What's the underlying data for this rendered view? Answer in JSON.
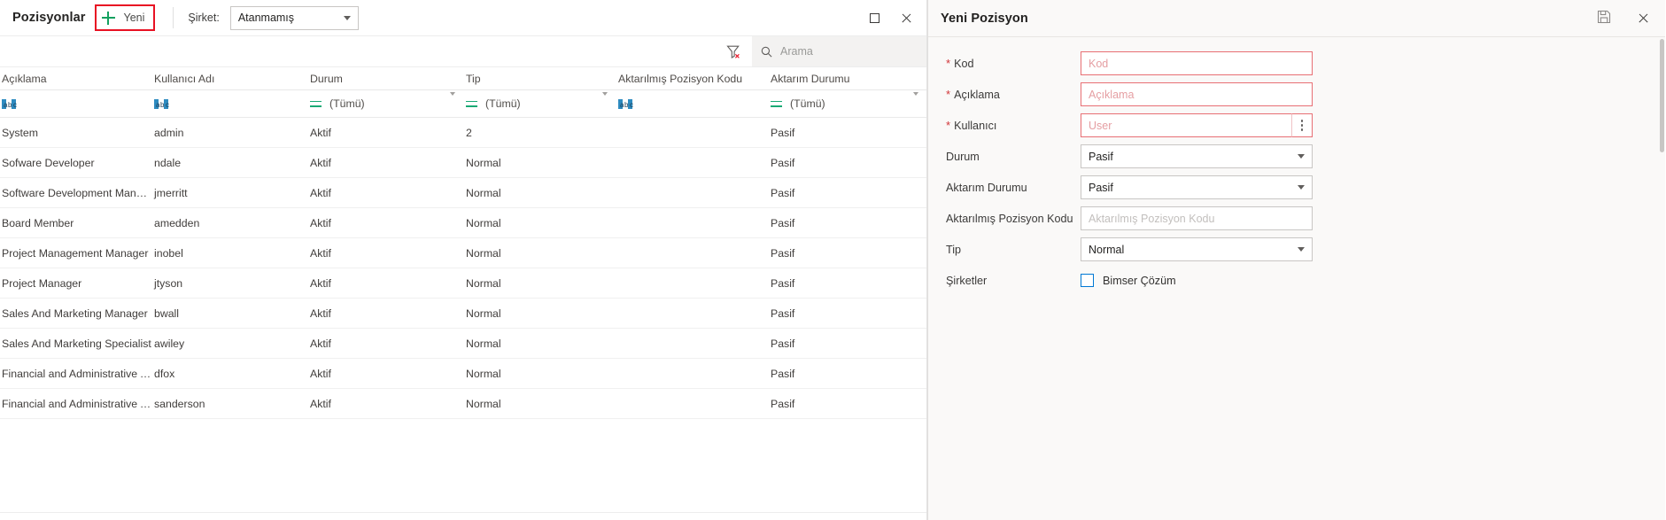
{
  "grid": {
    "toolbar": {
      "title": "Pozisyonlar",
      "new_label": "Yeni",
      "new_icon": "plus-icon",
      "company_label": "Şirket:",
      "company_value": "Atanmamış",
      "restore_icon": "restore-window-icon",
      "close_icon": "close-icon",
      "highlight_color": "#e81123",
      "plus_color": "#13a05f"
    },
    "search": {
      "clear_filter_icon": "funnel-clear-icon",
      "search_icon": "search-icon",
      "placeholder": "Arama",
      "value": ""
    },
    "columns": [
      "Açıklama",
      "Kullanıcı Adı",
      "Durum",
      "Tip",
      "Aktarılmış Pozisyon Kodu",
      "Aktarım Durumu"
    ],
    "filter_row": [
      {
        "mode": "text",
        "icon": "abc-filter-icon",
        "value": ""
      },
      {
        "mode": "text",
        "icon": "abc-filter-icon",
        "value": ""
      },
      {
        "mode": "equals",
        "icon": "equals-icon",
        "value": "(Tümü)",
        "has_chevron": true
      },
      {
        "mode": "equals",
        "icon": "equals-icon",
        "value": "(Tümü)",
        "has_chevron": true
      },
      {
        "mode": "text",
        "icon": "abc-filter-icon",
        "value": ""
      },
      {
        "mode": "equals",
        "icon": "equals-icon",
        "value": "(Tümü)",
        "has_chevron": true
      }
    ],
    "rows": [
      {
        "aciklama": "System",
        "kullanici": "admin",
        "durum": "Aktif",
        "tip": "2",
        "kod": "",
        "aktarim": "Pasif"
      },
      {
        "aciklama": "Sofware Developer",
        "kullanici": "ndale",
        "durum": "Aktif",
        "tip": "Normal",
        "kod": "",
        "aktarim": "Pasif"
      },
      {
        "aciklama": "Software Development Manager",
        "kullanici": "jmerritt",
        "durum": "Aktif",
        "tip": "Normal",
        "kod": "",
        "aktarim": "Pasif"
      },
      {
        "aciklama": "Board Member",
        "kullanici": "amedden",
        "durum": "Aktif",
        "tip": "Normal",
        "kod": "",
        "aktarim": "Pasif"
      },
      {
        "aciklama": "Project Management Manager",
        "kullanici": "inobel",
        "durum": "Aktif",
        "tip": "Normal",
        "kod": "",
        "aktarim": "Pasif"
      },
      {
        "aciklama": "Project Manager",
        "kullanici": "jtyson",
        "durum": "Aktif",
        "tip": "Normal",
        "kod": "",
        "aktarim": "Pasif"
      },
      {
        "aciklama": "Sales And Marketing Manager",
        "kullanici": "bwall",
        "durum": "Aktif",
        "tip": "Normal",
        "kod": "",
        "aktarim": "Pasif"
      },
      {
        "aciklama": "Sales And Marketing Specialist",
        "kullanici": "awiley",
        "durum": "Aktif",
        "tip": "Normal",
        "kod": "",
        "aktarim": "Pasif"
      },
      {
        "aciklama": "Financial and Administrative Affairs ...",
        "kullanici": "dfox",
        "durum": "Aktif",
        "tip": "Normal",
        "kod": "",
        "aktarim": "Pasif"
      },
      {
        "aciklama": "Financial and Administrative Affairs S...",
        "kullanici": "sanderson",
        "durum": "Aktif",
        "tip": "Normal",
        "kod": "",
        "aktarim": "Pasif"
      }
    ]
  },
  "panel": {
    "title": "Yeni Pozisyon",
    "save_icon": "save-disk-icon",
    "close_icon": "close-icon",
    "fields": {
      "kod": {
        "label": "Kod",
        "required": true,
        "placeholder": "Kod",
        "value": ""
      },
      "aciklama": {
        "label": "Açıklama",
        "required": true,
        "placeholder": "Açıklama",
        "value": ""
      },
      "kullanici": {
        "label": "Kullanıcı",
        "required": true,
        "placeholder": "User",
        "value": "",
        "lookup_icon": "ellipsis-vertical-icon"
      },
      "durum": {
        "label": "Durum",
        "required": false,
        "value": "Pasif"
      },
      "aktarim_durumu": {
        "label": "Aktarım Durumu",
        "required": false,
        "value": "Pasif"
      },
      "aktarilmis_kod": {
        "label": "Aktarılmış Pozisyon Kodu",
        "required": false,
        "placeholder": "Aktarılmış Pozisyon Kodu",
        "value": ""
      },
      "tip": {
        "label": "Tip",
        "required": false,
        "value": "Normal"
      },
      "sirketler": {
        "label": "Şirketler",
        "required": false,
        "checkbox_label": "Bimser Çözüm",
        "checked": false,
        "accent": "#0078d4"
      }
    }
  }
}
